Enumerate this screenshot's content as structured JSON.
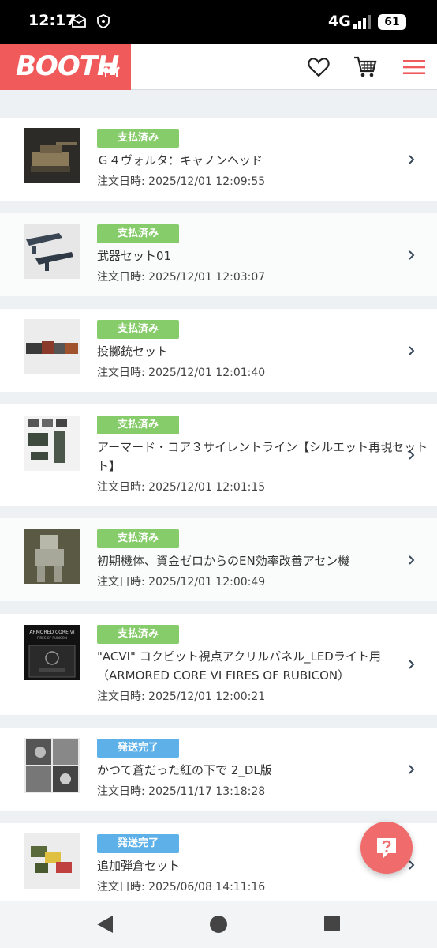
{
  "status": {
    "time": "12:17",
    "network": "4G",
    "battery": "61"
  },
  "header": {
    "logo_text": "BOOTH"
  },
  "orders": [
    {
      "status": "支払済み",
      "title": "Ｇ４ヴォルタ：キャノンヘッド",
      "date": "注文日時: 2025/12/01 12:09:55"
    },
    {
      "status": "支払済み",
      "title": "武器セット01",
      "date": "注文日時: 2025/12/01 12:03:07"
    },
    {
      "status": "支払済み",
      "title": "投擲銃セット",
      "date": "注文日時: 2025/12/01 12:01:40"
    },
    {
      "status": "支払済み",
      "title_line1": "アーマード・コア３サイレントライン【シルエット再現セット",
      "title_line2": "ト】",
      "date": "注文日時: 2025/12/01 12:01:15"
    },
    {
      "status": "支払済み",
      "title": "初期機体、資金ゼロからのEN効率改善アセン機",
      "date": "注文日時: 2025/12/01 12:00:49"
    },
    {
      "status": "支払済み",
      "title_line1": "\"ACVI\" コクピット視点アクリルパネル_LEDライト用",
      "title_line2": "（ARMORED CORE VI FIRES OF RUBICON）",
      "date": "注文日時: 2025/12/01 12:00:21",
      "thumb_text_1": "ARMORED CORE VI",
      "thumb_text_2": "FIRES OF RUBICON"
    },
    {
      "status": "発送完了",
      "title": "かつて蒼だった紅の下で 2_DL版",
      "date": "注文日時: 2025/11/17 13:18:28"
    },
    {
      "status": "発送完了",
      "title": "追加弾倉セット",
      "date": "注文日時: 2025/06/08 14:11:16"
    }
  ],
  "colors": {
    "brand": "#f05a5a",
    "paid": "#86cc6a",
    "shipped": "#5db0e8"
  }
}
